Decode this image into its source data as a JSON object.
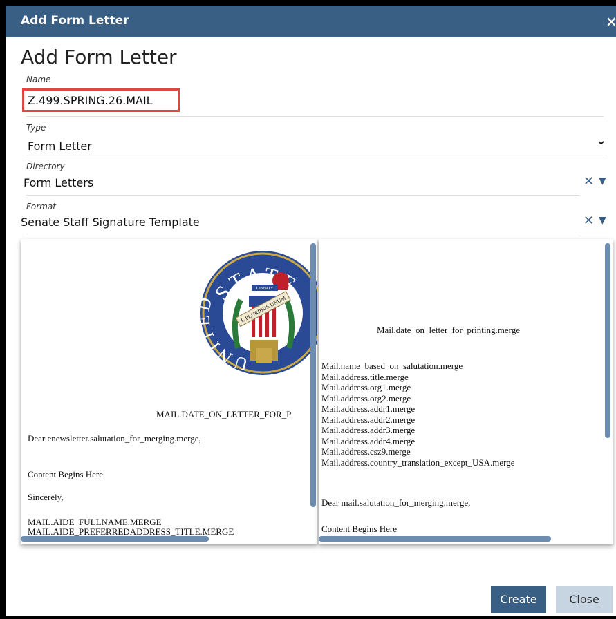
{
  "dialog": {
    "title": "Add Form Letter",
    "close_glyph": "×"
  },
  "heading": "Add Form Letter",
  "fields": {
    "name": {
      "label": "Name",
      "value": "Z.499.SPRING.26.MAIL"
    },
    "type": {
      "label": "Type",
      "value": "Form Letter",
      "dropdown_glyph": "⌄"
    },
    "directory": {
      "label": "Directory",
      "value": "Form Letters",
      "clear_glyph": "✕",
      "dropdown_glyph": "▼"
    },
    "format": {
      "label": "Format",
      "value": "Senate Staff Signature Template",
      "clear_glyph": "✕",
      "dropdown_glyph": "▼"
    }
  },
  "preview_left": {
    "seal_text": {
      "top": "STATE",
      "banner": "E PLURIBUS UNUM",
      "side": "UNITED",
      "ribbon": "LIBERTY"
    },
    "date_line": "MAIL.DATE_ON_LETTER_FOR_P",
    "salutation": "Dear enewsletter.salutation_for_merging.merge,",
    "content": "Content Begins Here",
    "closing": "Sincerely,",
    "aide_name": "MAIL.AIDE_FULLNAME.MERGE",
    "aide_title": "MAIL.AIDE_PREFERREDADDRESS_TITLE.MERGE"
  },
  "preview_right": {
    "date_line": "Mail.date_on_letter_for_printing.merge",
    "address_lines": [
      "Mail.name_based_on_salutation.merge",
      "Mail.address.title.merge",
      "Mail.address.org1.merge",
      "Mail.address.org2.merge",
      "Mail.address.addr1.merge",
      "Mail.address.addr2.merge",
      "Mail.address.addr3.merge",
      "Mail.address.addr4.merge",
      "Mail.address.csz9.merge",
      "Mail.address.country_translation_except_USA.merge"
    ],
    "salutation": "Dear mail.salutation_for_merging.merge,",
    "content": "Content Begins Here"
  },
  "buttons": {
    "create": "Create",
    "close": "Close"
  },
  "colors": {
    "titlebar": "#3a5f85",
    "highlight": "#e0483f",
    "close_button": "#c7d5e3",
    "scrollbar": "#6c8db0"
  }
}
